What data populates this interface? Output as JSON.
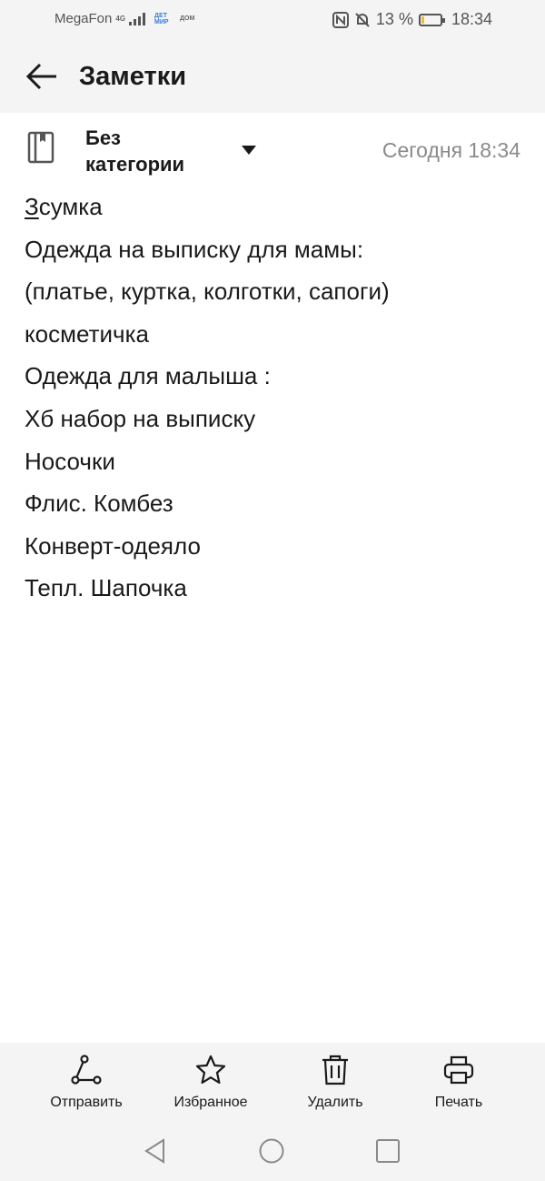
{
  "status_bar": {
    "carrier": "MegaFon",
    "network": "4G",
    "mini_logo_1": "ДЕТ МИР",
    "mini_logo_2": "ДОМ",
    "battery": "13 %",
    "battery_level": 0.13,
    "time": "18:34"
  },
  "app_bar": {
    "title": "Заметки"
  },
  "note": {
    "category_line1": "Без",
    "category_line2": "категории",
    "date": "Сегодня 18:34",
    "first_char": "З",
    "first_rest": "сумка",
    "lines": [
      "Одежда на выписку для мамы:",
      "(платье, куртка, колготки, сапоги)",
      "косметичка",
      "Одежда для малыша :",
      "Хб набор на выписку",
      "Носочки",
      "Флис. Комбез",
      "Конверт-одеяло",
      "Тепл. Шапочка"
    ]
  },
  "toolbar": {
    "share": "Отправить",
    "favorite": "Избранное",
    "delete": "Удалить",
    "print": "Печать"
  },
  "colors": {
    "bar_bg": "#f4f4f4",
    "text": "#1a1a1a",
    "muted": "#8a8a8a",
    "battery": "#f3b736"
  }
}
